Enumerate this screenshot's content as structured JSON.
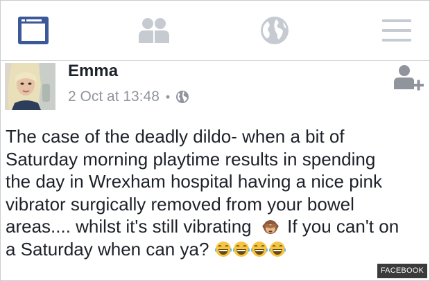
{
  "nav": {
    "items": [
      {
        "icon": "news-feed-icon",
        "active": true
      },
      {
        "icon": "friends-icon",
        "active": false
      },
      {
        "icon": "globe-notifications-icon",
        "active": false
      },
      {
        "icon": "menu-icon",
        "active": false
      }
    ],
    "active_color": "#3b5998",
    "inactive_color": "#c6cbd2"
  },
  "post": {
    "author": "Emma",
    "timestamp": "2 Oct at 13:48",
    "separator": "•",
    "privacy_icon": "globe-icon",
    "text_lines": [
      "The case of the deadly dildo- when a bit of",
      "Saturday morning playtime results in  spending",
      "the day in Wrexham hospital having a nice pink",
      "vibrator surgically removed from your bowel",
      "areas.... whilst it's still vibrating",
      "If you can't on",
      "a Saturday when can ya?"
    ],
    "inline_emoji": "see-no-evil-monkey-emoji",
    "trailing_emojis": [
      "laughing-tears-emoji",
      "laughing-tears-emoji",
      "laughing-tears-emoji",
      "laughing-tears-emoji"
    ]
  },
  "watermark": "FACEBOOK"
}
